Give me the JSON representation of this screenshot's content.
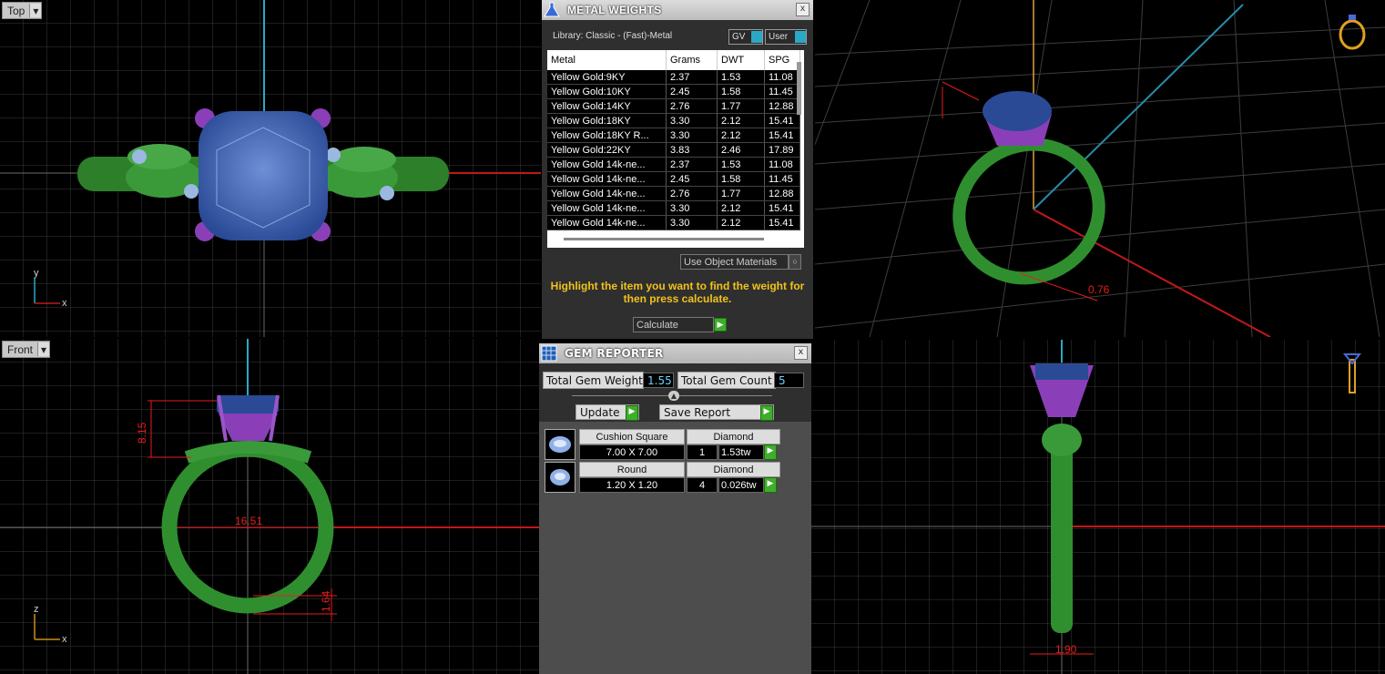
{
  "viewports": {
    "top": {
      "label": "Top",
      "axis_y": "y",
      "axis_x": "x"
    },
    "front": {
      "label": "Front",
      "axis_z": "z",
      "axis_x": "x",
      "dim_height": "8.15",
      "dim_width": "16.51",
      "dim_shank": "1.64"
    },
    "side": {
      "dim_width": "1.90"
    },
    "persp": {
      "dim_small": "0.76"
    }
  },
  "metal_weights": {
    "title": "METAL WEIGHTS",
    "close": "x",
    "library": "Library: Classic - (Fast)-Metal",
    "gv_label": "GV",
    "user_label": "User",
    "headers": [
      "Metal",
      "Grams",
      "DWT",
      "SPG"
    ],
    "rows": [
      [
        "Yellow Gold:9KY",
        "2.37",
        "1.53",
        "11.08"
      ],
      [
        "Yellow Gold:10KY",
        "2.45",
        "1.58",
        "11.45"
      ],
      [
        "Yellow Gold:14KY",
        "2.76",
        "1.77",
        "12.88"
      ],
      [
        "Yellow Gold:18KY",
        "3.30",
        "2.12",
        "15.41"
      ],
      [
        "Yellow Gold:18KY R...",
        "3.30",
        "2.12",
        "15.41"
      ],
      [
        "Yellow Gold:22KY",
        "3.83",
        "2.46",
        "17.89"
      ],
      [
        "Yellow Gold 14k-ne...",
        "2.37",
        "1.53",
        "11.08"
      ],
      [
        "Yellow Gold 14k-ne...",
        "2.45",
        "1.58",
        "11.45"
      ],
      [
        "Yellow Gold 14k-ne...",
        "2.76",
        "1.77",
        "12.88"
      ],
      [
        "Yellow Gold 14k-ne...",
        "3.30",
        "2.12",
        "15.41"
      ],
      [
        "Yellow Gold 14k-ne...",
        "3.30",
        "2.12",
        "15.41"
      ]
    ],
    "use_object_materials": "Use Object Materials",
    "message": "Highlight the item you want to find the weight for then press calculate.",
    "calculate": "Calculate"
  },
  "gem_reporter": {
    "title": "GEM REPORTER",
    "close": "x",
    "total_weight_label": "Total Gem Weight",
    "total_weight_value": "1.55",
    "total_count_label": "Total Gem Count",
    "total_count_value": "5",
    "update_label": "Update",
    "save_report_label": "Save Report",
    "gems": [
      {
        "shape": "Cushion Square",
        "type": "Diamond",
        "size": "7.00 X 7.00",
        "count": "1",
        "weight": "1.53tw"
      },
      {
        "shape": "Round",
        "type": "Diamond",
        "size": "1.20 X 1.20",
        "count": "4",
        "weight": "0.026tw"
      }
    ]
  },
  "colors": {
    "metal": "#2f8f2f",
    "prong": "#8a3fb8",
    "gem": "#3b5da8",
    "dimension": "#e81d1d",
    "accent_text": "#f2c21b"
  }
}
